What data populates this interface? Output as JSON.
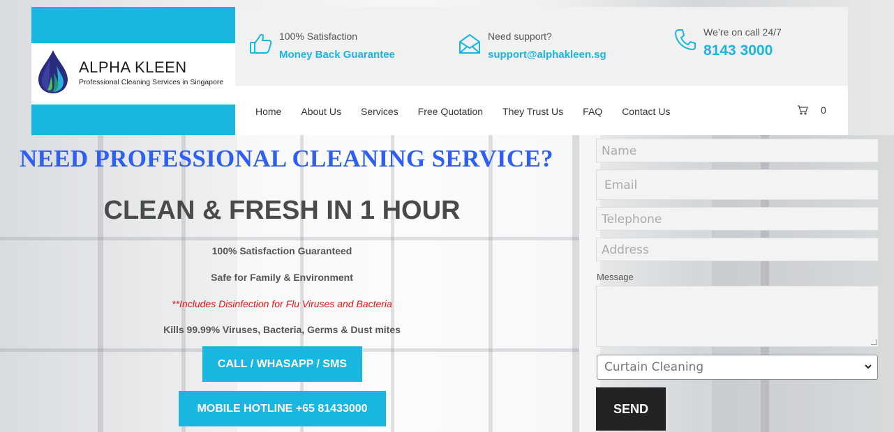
{
  "brand": {
    "name": "ALPHA KLEEN",
    "tagline": "Professional Cleaning Services in Singapore",
    "accent_color": "#19b6e0",
    "headline_color": "#2f5ef2"
  },
  "topbar": {
    "satisfaction": {
      "icon": "thumbs-up-icon",
      "label": "100% Satisfaction",
      "value": "Money Back Guarantee"
    },
    "support": {
      "icon": "envelope-icon",
      "label": "Need support?",
      "value": "support@alphakleen.sg"
    },
    "call": {
      "icon": "phone-icon",
      "label": "We’re on call 24/7",
      "value": "8143 3000"
    }
  },
  "nav": {
    "items": [
      "Home",
      "About Us",
      "Services",
      "Free Quotation",
      "They Trust Us",
      "FAQ",
      "Contact Us"
    ],
    "cart_icon": "cart-icon",
    "cart_count": "0"
  },
  "hero": {
    "headline": "NEED PROFESSIONAL CLEANING SERVICE?",
    "subhead": "CLEAN & FRESH IN 1 HOUR",
    "line1": "100% Satisfaction Guaranteed",
    "line2": "Safe for Family & Environment",
    "line3": "**Includes Disinfection for Flu Viruses and Bacteria",
    "line4": "Kills 99.99% Viruses, Bacteria, Germs & Dust mites",
    "button_call": "CALL / WHASAPP / SMS",
    "button_hotline": "MOBILE HOTLINE +65 81433000"
  },
  "form": {
    "name_placeholder": "Name",
    "email_placeholder": "Email",
    "telephone_placeholder": "Telephone",
    "address_placeholder": "Address",
    "message_label": "Message",
    "service_selected": "Curtain Cleaning",
    "send_label": "SEND"
  }
}
